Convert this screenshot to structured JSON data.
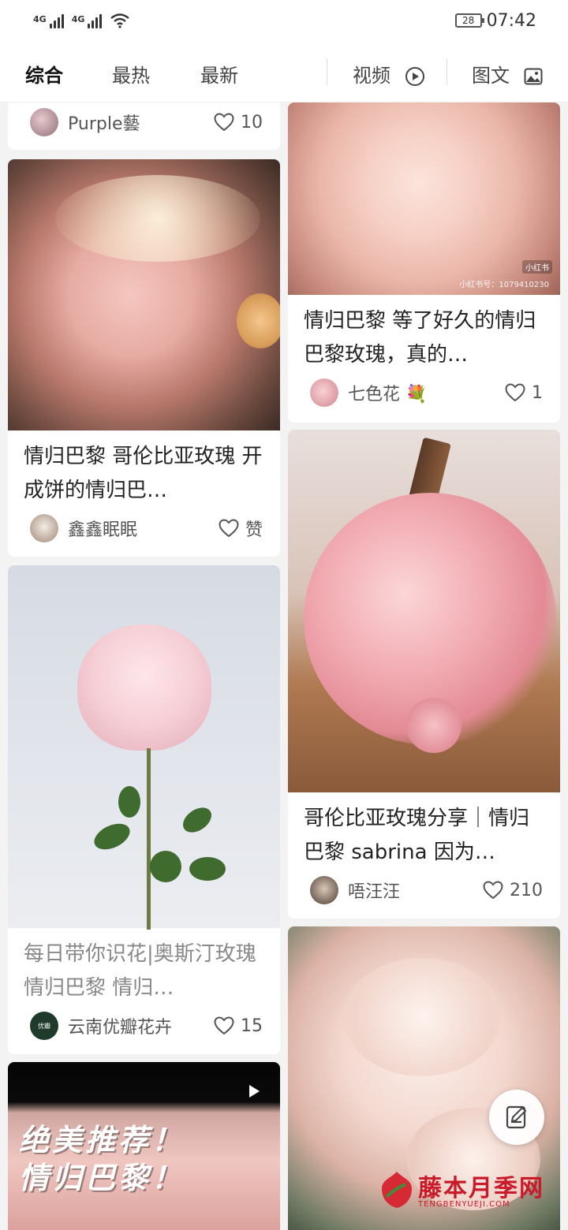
{
  "status_bar": {
    "network_1": "4G",
    "network_2": "4G",
    "battery": "28",
    "time": "07:42"
  },
  "tabs": [
    {
      "label": "综合",
      "active": true
    },
    {
      "label": "最热",
      "active": false
    },
    {
      "label": "最新",
      "active": false
    },
    {
      "label": "视频",
      "icon": "play-circle-icon"
    },
    {
      "label": "图文",
      "icon": "image-icon"
    }
  ],
  "cards": [
    {
      "author": "Purple藝",
      "likes": "10"
    },
    {
      "title": "情归巴黎 等了好久的情归巴黎玫瑰，真的…",
      "author": "七色花",
      "likes": "1",
      "image_watermark": "小红书号：1079410230",
      "image_watermark_badge": "小红书"
    },
    {
      "title": "情归巴黎 哥伦比亚玫瑰 开成饼的情归巴…",
      "author": "鑫鑫眠眠",
      "likes": "赞"
    },
    {
      "title": "哥伦比亚玫瑰分享｜情归巴黎 sabrina 因为…",
      "author": "唔汪汪",
      "likes": "210"
    },
    {
      "title": "每日带你识花|奥斯汀玫瑰情归巴黎 情归…",
      "author": "云南优瓣花卉",
      "likes": "15",
      "avatar_text": "优瓣"
    },
    {
      "overlay_line1": "绝美推荐！",
      "overlay_line2": "情归巴黎！",
      "is_video": true
    }
  ],
  "watermark": {
    "main": "藤本月季网",
    "sub": "TENGBENYUEJI.COM"
  },
  "colors": {
    "accent": "#c91a2a",
    "background": "#f3f3f3"
  }
}
